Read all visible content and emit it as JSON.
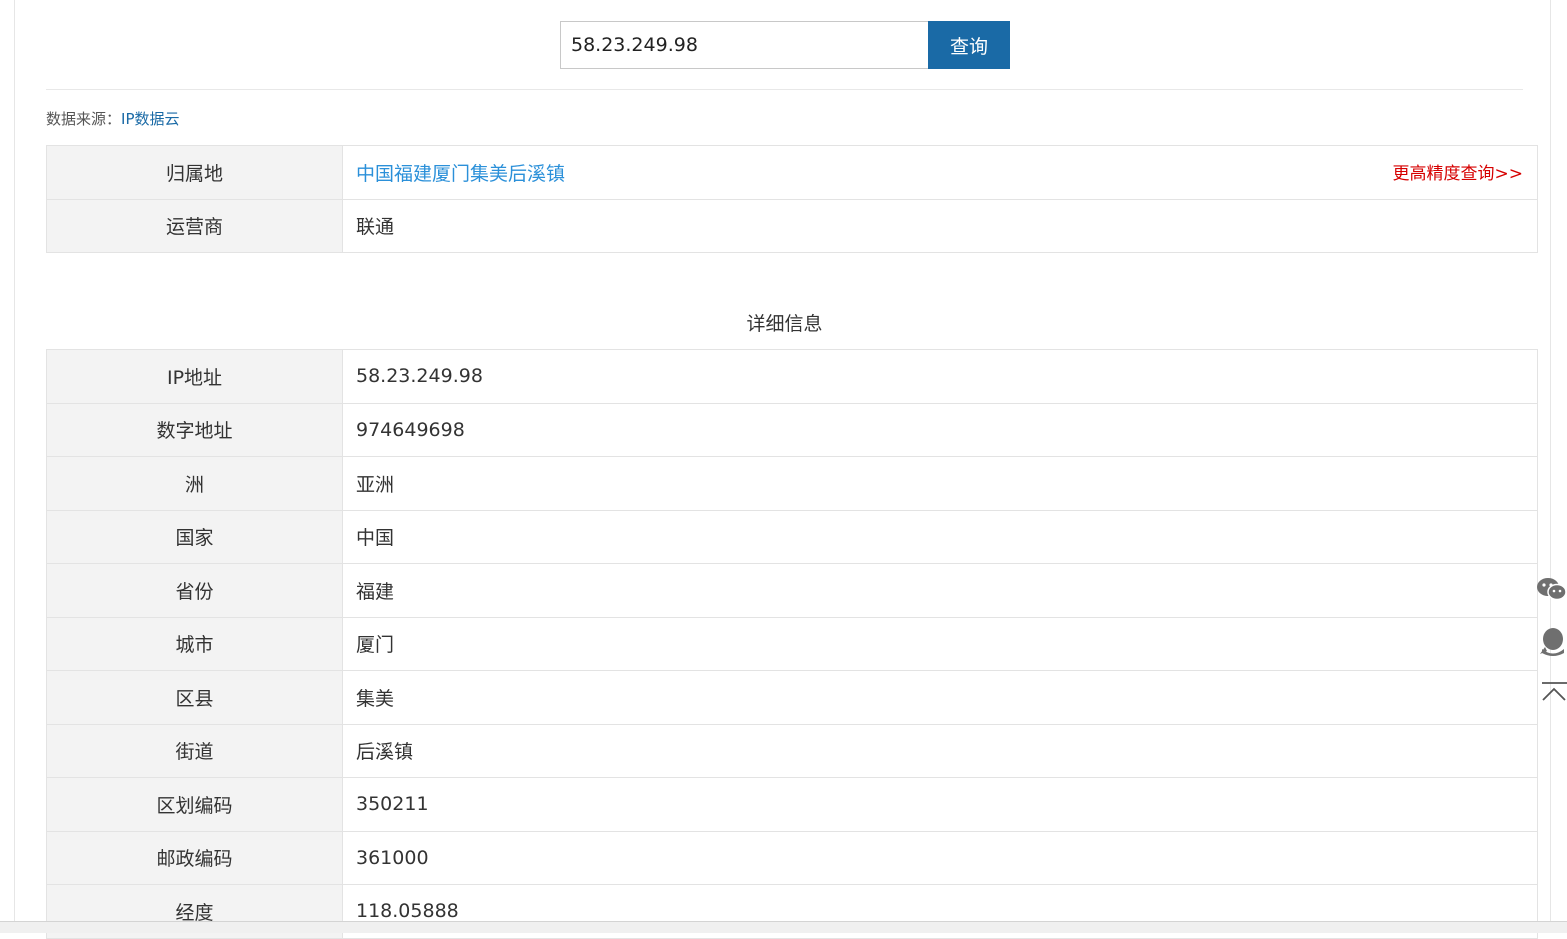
{
  "search": {
    "value": "58.23.249.98",
    "button_label": "查询"
  },
  "source": {
    "label": "数据来源：",
    "link": "IP数据云"
  },
  "summary": {
    "rows": [
      {
        "label": "归属地",
        "value": "中国福建厦门集美后溪镇",
        "action": "更高精度查询>>"
      },
      {
        "label": "运营商",
        "value": "联通"
      }
    ]
  },
  "details": {
    "title": "详细信息",
    "rows": [
      {
        "label": "IP地址",
        "value": "58.23.249.98"
      },
      {
        "label": "数字地址",
        "value": "974649698"
      },
      {
        "label": "洲",
        "value": "亚洲"
      },
      {
        "label": "国家",
        "value": "中国"
      },
      {
        "label": "省份",
        "value": "福建"
      },
      {
        "label": "城市",
        "value": "厦门"
      },
      {
        "label": "区县",
        "value": "集美"
      },
      {
        "label": "街道",
        "value": "后溪镇"
      },
      {
        "label": "区划编码",
        "value": "350211"
      },
      {
        "label": "邮政编码",
        "value": "361000"
      },
      {
        "label": "经度",
        "value": "118.05888"
      }
    ]
  },
  "side_icons": [
    "wechat-icon",
    "qq-icon",
    "back-to-top-icon"
  ],
  "colors": {
    "accent": "#1a6aa6",
    "link": "#2b90d9",
    "action": "#d60000",
    "label_bg": "#f3f3f3"
  }
}
